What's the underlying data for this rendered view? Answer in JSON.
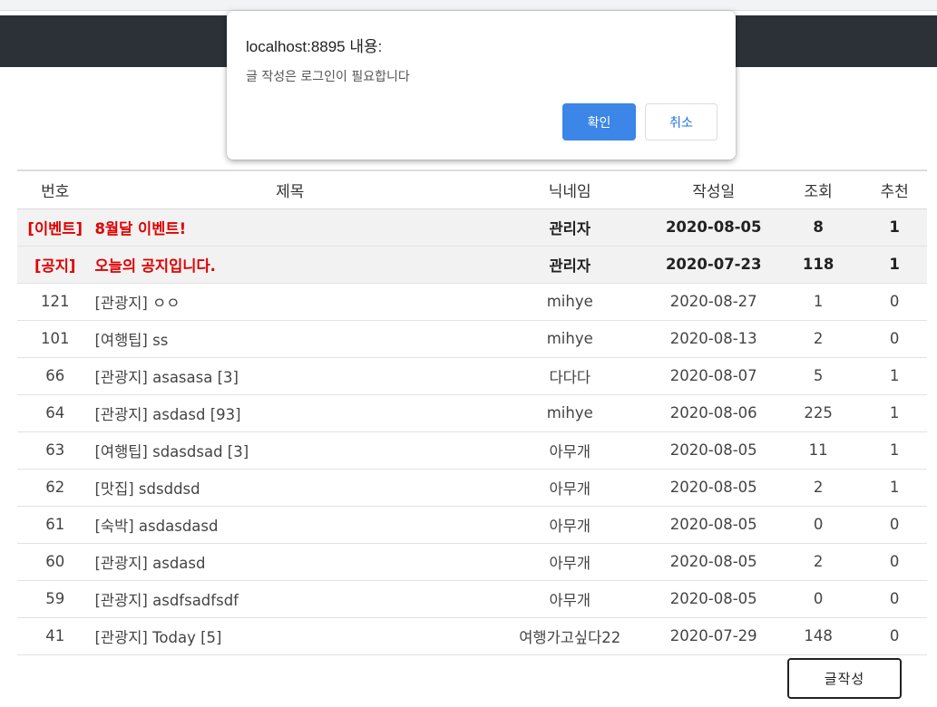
{
  "browser": {
    "truncated_text": ""
  },
  "table": {
    "headers": {
      "no": "번호",
      "title": "제목",
      "nickname": "닉네임",
      "date": "작성일",
      "views": "조회",
      "recommend": "추천"
    },
    "pinned": [
      {
        "category": "[이벤트]",
        "title": "8월달 이벤트!",
        "nickname": "관리자",
        "date": "2020-08-05",
        "views": "8",
        "recommend": "1"
      },
      {
        "category": "[공지]",
        "title": "오늘의 공지입니다.",
        "nickname": "관리자",
        "date": "2020-07-23",
        "views": "118",
        "recommend": "1"
      }
    ],
    "rows": [
      {
        "no": "121",
        "title": "[관광지] ㅇㅇ",
        "nickname": "mihye",
        "date": "2020-08-27",
        "views": "1",
        "recommend": "0"
      },
      {
        "no": "101",
        "title": "[여행팁] ss",
        "nickname": "mihye",
        "date": "2020-08-13",
        "views": "2",
        "recommend": "0"
      },
      {
        "no": "66",
        "title": "[관광지] asasasa [3]",
        "nickname": "다다다",
        "date": "2020-08-07",
        "views": "5",
        "recommend": "1"
      },
      {
        "no": "64",
        "title": "[관광지] asdasd [93]",
        "nickname": "mihye",
        "date": "2020-08-06",
        "views": "225",
        "recommend": "1"
      },
      {
        "no": "63",
        "title": "[여행팁] sdasdsad [3]",
        "nickname": "아무개",
        "date": "2020-08-05",
        "views": "11",
        "recommend": "1"
      },
      {
        "no": "62",
        "title": "[맛집] sdsddsd",
        "nickname": "아무개",
        "date": "2020-08-05",
        "views": "2",
        "recommend": "1"
      },
      {
        "no": "61",
        "title": "[숙박] asdasdasd",
        "nickname": "아무개",
        "date": "2020-08-05",
        "views": "0",
        "recommend": "0"
      },
      {
        "no": "60",
        "title": "[관광지] asdasd",
        "nickname": "아무개",
        "date": "2020-08-05",
        "views": "2",
        "recommend": "0"
      },
      {
        "no": "59",
        "title": "[관광지] asdfsadfsdf",
        "nickname": "아무개",
        "date": "2020-08-05",
        "views": "0",
        "recommend": "0"
      },
      {
        "no": "41",
        "title": "[관광지] Today [5]",
        "nickname": "여행가고싶다22",
        "date": "2020-07-29",
        "views": "148",
        "recommend": "0"
      }
    ]
  },
  "write_button": {
    "label": "글작성"
  },
  "dialog": {
    "title": "localhost:8895 내용:",
    "message": "글 작성은 로그인이 필요합니다",
    "ok_label": "확인",
    "cancel_label": "취소",
    "ok_color": "#3b86e6"
  },
  "colors": {
    "navbar": "#2b3137",
    "pinned_text": "#e00000",
    "pinned_bg": "#f2f2f2"
  }
}
